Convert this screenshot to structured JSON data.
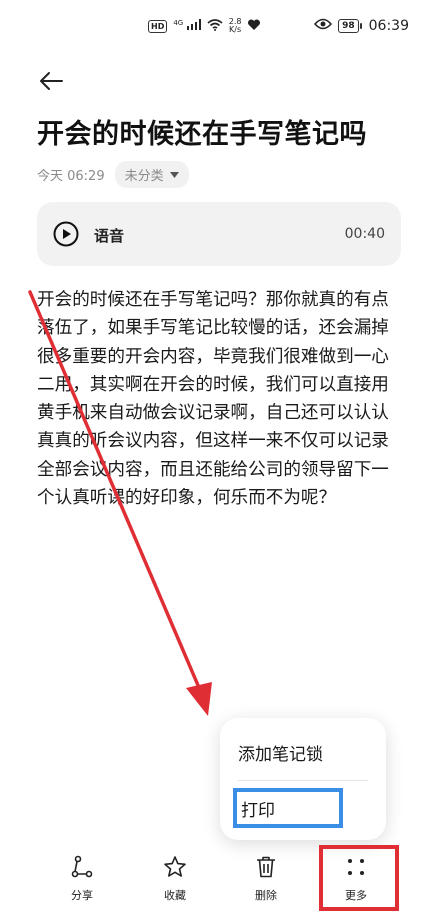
{
  "status_bar": {
    "network_badge": "HD",
    "signal_text": "4G",
    "speed_value": "2.8",
    "speed_unit": "K/s",
    "battery": "98",
    "time": "06:39"
  },
  "note": {
    "title": "开会的时候还在手写笔记吗",
    "timestamp": "今天 06:29",
    "category": "未分类",
    "audio": {
      "label": "语音",
      "duration": "00:40"
    },
    "body": "开会的时候还在手写笔记吗？那你就真的有点落伍了，如果手写笔记比较慢的话，还会漏掉很多重要的开会内容，毕竟我们很难做到一心二用，其实啊在开会的时候，我们可以直接用黄手机来自动做会议记录啊，自己还可以认认真真的听会议内容，但这样一来不仅可以记录全部会议内容，而且还能给公司的领导留下一个认真听课的好印象，何乐而不为呢？"
  },
  "more_menu": {
    "items": [
      "添加笔记锁",
      "打印"
    ]
  },
  "toolbar": {
    "share": "分享",
    "favorite": "收藏",
    "delete": "删除",
    "more": "更多"
  },
  "colors": {
    "annotation_red": "#e02e35",
    "annotation_blue": "#3a8ee6"
  },
  "icons": [
    "back-arrow-icon",
    "play-icon",
    "dropdown-triangle-icon",
    "share-icon",
    "star-icon",
    "trash-icon",
    "more-dots-icon",
    "wifi-icon",
    "eye-icon",
    "heart-icon"
  ]
}
